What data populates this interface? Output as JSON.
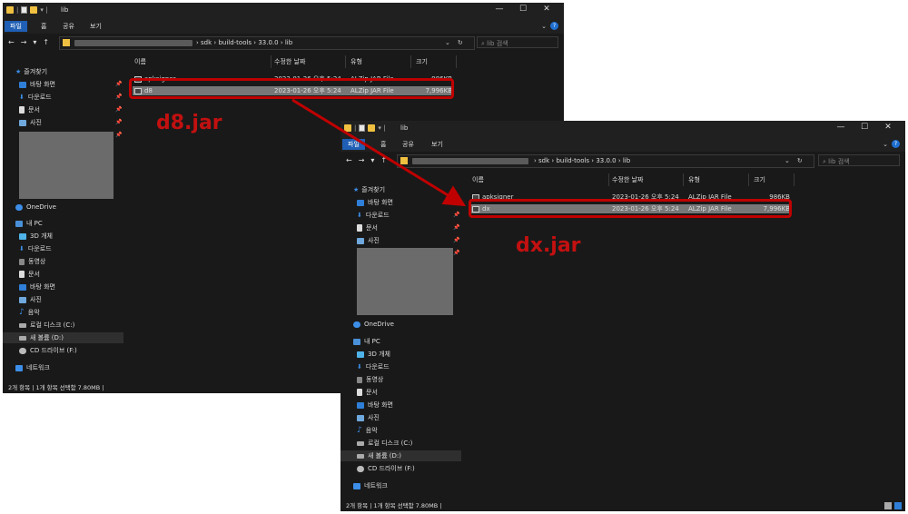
{
  "windows": [
    {
      "title": "lib",
      "tabs": [
        "파일",
        "홈",
        "공유",
        "보기"
      ],
      "window_controls": [
        "—",
        "☐",
        "✕"
      ],
      "path": [
        "sdk",
        "build-tools",
        "33.0.0",
        "lib"
      ],
      "search_placeholder": "lib 검색",
      "sidebar": {
        "quick_access_label": "즐겨찾기",
        "quick_items": [
          "바탕 화면",
          "다운로드",
          "문서",
          "사진"
        ],
        "onedrive": "OneDrive",
        "pc_label": "내 PC",
        "pc_items": [
          "3D 개체",
          "다운로드",
          "동영상",
          "문서",
          "바탕 화면",
          "사진",
          "음악",
          "로컬 디스크 (C:)",
          "새 볼륨 (D:)",
          "CD 드라이브 (F:)"
        ],
        "network": "네트워크"
      },
      "columns": [
        "이름",
        "수정한 날짜",
        "유형",
        "크기"
      ],
      "files": [
        {
          "name": "apksigner",
          "date": "2023-01-26 오후 5:24",
          "type": "ALZip JAR File",
          "size": "986KB"
        },
        {
          "name": "d8",
          "date": "2023-01-26 오후 5:24",
          "type": "ALZip JAR File",
          "size": "7,996KB"
        }
      ],
      "status": "2개 항목  |  1개 항목 선택함 7.80MB  |"
    },
    {
      "title": "lib",
      "tabs": [
        "파일",
        "홈",
        "공유",
        "보기"
      ],
      "window_controls": [
        "—",
        "☐",
        "✕"
      ],
      "path": [
        "sdk",
        "build-tools",
        "33.0.0",
        "lib"
      ],
      "search_placeholder": "lib 검색",
      "sidebar": {
        "quick_access_label": "즐겨찾기",
        "quick_items": [
          "바탕 화면",
          "다운로드",
          "문서",
          "사진"
        ],
        "onedrive": "OneDrive",
        "pc_label": "내 PC",
        "pc_items": [
          "3D 개체",
          "다운로드",
          "동영상",
          "문서",
          "바탕 화면",
          "사진",
          "음악",
          "로컬 디스크 (C:)",
          "새 볼륨 (D:)",
          "CD 드라이브 (F:)"
        ],
        "network": "네트워크"
      },
      "columns": [
        "이름",
        "수정한 날짜",
        "유형",
        "크기"
      ],
      "files": [
        {
          "name": "apksigner",
          "date": "2023-01-26 오후 5:24",
          "type": "ALZip JAR File",
          "size": "986KB"
        },
        {
          "name": "dx",
          "date": "2023-01-26 오후 5:24",
          "type": "ALZip JAR File",
          "size": "7,996KB"
        }
      ],
      "status": "2개 항목  |  1개 항목 선택함 7.80MB  |"
    }
  ],
  "callouts": {
    "first": "d8.jar",
    "second": "dx.jar"
  },
  "colors": {
    "highlight": "#c00000",
    "callout_text": "#c21010",
    "accent_tab": "#1f5fb5"
  },
  "icons": {
    "folder": "folder-icon",
    "jar": "jar-file-icon",
    "pin": "pin-icon",
    "star": "star-icon"
  }
}
